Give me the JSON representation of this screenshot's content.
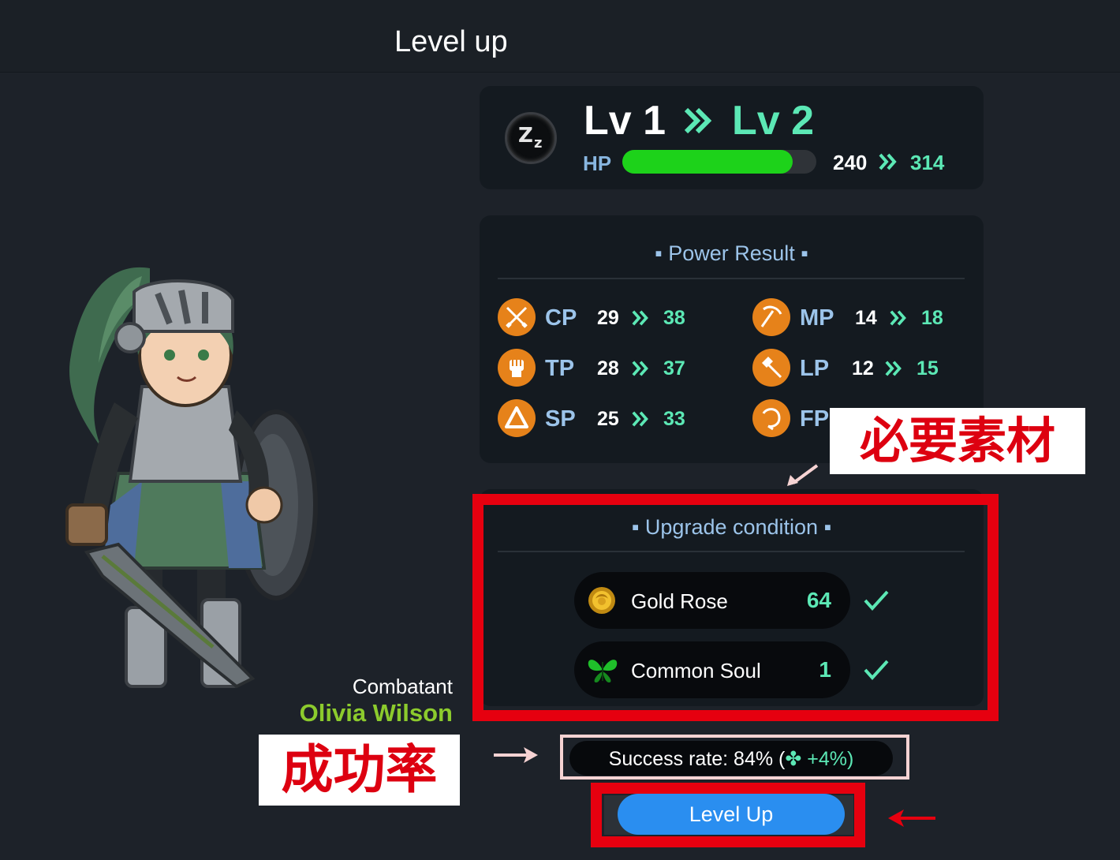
{
  "header": {
    "title": "Level up"
  },
  "level": {
    "from_label": "Lv 1",
    "to_label": "Lv 2",
    "hp_label": "HP",
    "hp_fill_fraction": 0.88,
    "hp_from": "240",
    "hp_to": "314",
    "status_icon": "sleep-zz-icon"
  },
  "power": {
    "title": "▪ Power Result ▪",
    "stats": [
      {
        "name": "CP",
        "from": "29",
        "to": "38",
        "icon": "crossed-swords-icon"
      },
      {
        "name": "MP",
        "from": "14",
        "to": "18",
        "icon": "pickaxe-icon"
      },
      {
        "name": "TP",
        "from": "28",
        "to": "37",
        "icon": "fist-icon"
      },
      {
        "name": "LP",
        "from": "12",
        "to": "15",
        "icon": "axe-icon"
      },
      {
        "name": "SP",
        "from": "25",
        "to": "33",
        "icon": "triangle-swirl-icon"
      },
      {
        "name": "FP",
        "from": "",
        "to": "",
        "icon": "sickle-icon"
      }
    ]
  },
  "upgrade": {
    "title": "▪ Upgrade condition ▪",
    "materials": [
      {
        "name": "Gold Rose",
        "qty": "64",
        "icon": "gold-rose-icon"
      },
      {
        "name": "Common Soul",
        "qty": "1",
        "icon": "green-butterfly-icon"
      }
    ]
  },
  "success": {
    "text": "Success rate: 84% (",
    "bonus": "+4%)"
  },
  "actions": {
    "level_up_label": "Level Up"
  },
  "combatant": {
    "label": "Combatant",
    "name": "Olivia Wilson"
  },
  "annotations": {
    "required_materials": "必要素材",
    "success_rate": "成功率"
  },
  "colors": {
    "accent_teal": "#5ce8b5",
    "hp_green": "#1dd21a",
    "button_blue": "#2a8ef0",
    "annotation_red": "#e6000f",
    "stat_orange": "#e6821a",
    "name_green": "#8ccb2d"
  }
}
